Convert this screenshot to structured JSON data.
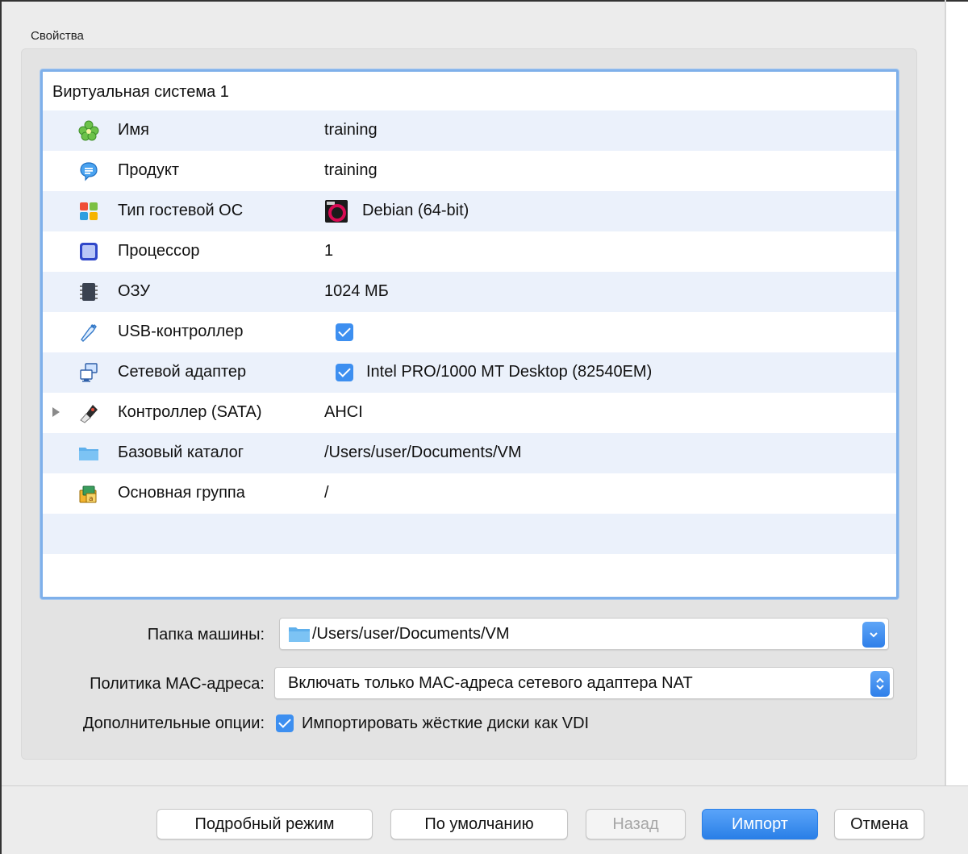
{
  "group_title": "Свойства",
  "tree": {
    "header": "Виртуальная система 1",
    "rows": [
      {
        "label": "Имя",
        "value": "training",
        "icon": "name-icon"
      },
      {
        "label": "Продукт",
        "value": "training",
        "icon": "product-icon"
      },
      {
        "label": "Тип гостевой ОС",
        "value": "Debian (64-bit)",
        "icon": "os-type-icon"
      },
      {
        "label": "Процессор",
        "value": "1",
        "icon": "cpu-icon"
      },
      {
        "label": "ОЗУ",
        "value": "1024 МБ",
        "icon": "ram-icon"
      },
      {
        "label": "USB-контроллер",
        "value": "",
        "icon": "usb-icon",
        "checked": true
      },
      {
        "label": "Сетевой адаптер",
        "value": "Intel PRO/1000 MT Desktop (82540EM)",
        "icon": "network-adapter-icon",
        "checked": true
      },
      {
        "label": "Контроллер (SATA)",
        "value": "AHCI",
        "icon": "sata-controller-icon"
      },
      {
        "label": "Базовый каталог",
        "value": "/Users/user/Documents/VM",
        "icon": "folder-icon"
      },
      {
        "label": "Основная группа",
        "value": "/",
        "icon": "group-icon"
      }
    ]
  },
  "form": {
    "folder_label": "Папка машины:",
    "folder_value": "/Users/user/Documents/VM",
    "mac_label": "Политика MAC-адреса:",
    "mac_value": "Включать только MAC-адреса сетевого адаптера NAT",
    "options_label": "Дополнительные опции:",
    "options_value": "Импортировать жёсткие диски как VDI",
    "options_checked": true
  },
  "buttons": {
    "expert": "Подробный режим",
    "defaults": "По умолчанию",
    "back": "Назад",
    "import": "Импорт",
    "cancel": "Отмена"
  },
  "colors": {
    "accent": "#3d8ff0",
    "row_alt": "#ebf1fb",
    "tree_focus_border": "#7fb0ea"
  }
}
